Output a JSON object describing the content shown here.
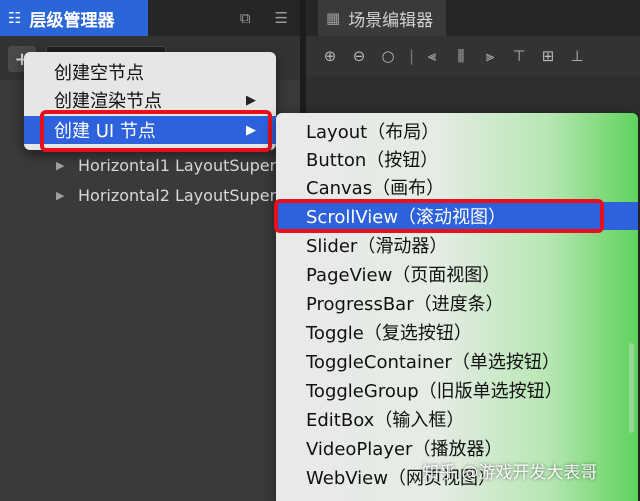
{
  "hierarchy": {
    "tab_title": "层级管理器",
    "tab_icon": "hierarchy-icon",
    "tree": [
      {
        "label": "Horizontal1 LayoutSuper"
      },
      {
        "label": "Horizontal2 LayoutSuper"
      }
    ]
  },
  "scene": {
    "tab_title": "场景编辑器"
  },
  "context_menu": {
    "items": [
      {
        "label": "创建空节点",
        "has_submenu": false
      },
      {
        "label": "创建渲染节点",
        "has_submenu": true
      },
      {
        "label": "创建 UI 节点",
        "has_submenu": true,
        "active": true
      }
    ]
  },
  "submenu": {
    "items": [
      {
        "label": "Layout（布局）"
      },
      {
        "label": "Button（按钮）"
      },
      {
        "label": "Canvas（画布）"
      },
      {
        "label": "ScrollView（滚动视图）",
        "active": true
      },
      {
        "label": "Slider（滑动器）"
      },
      {
        "label": "PageView（页面视图）"
      },
      {
        "label": "ProgressBar（进度条）"
      },
      {
        "label": "Toggle（复选按钮）"
      },
      {
        "label": "ToggleContainer（单选按钮）"
      },
      {
        "label": "ToggleGroup（旧版单选按钮）"
      },
      {
        "label": "EditBox（输入框）"
      },
      {
        "label": "VideoPlayer（播放器）"
      },
      {
        "label": "WebView（网页视图）"
      }
    ]
  },
  "watermark": "知乎 @游戏开发大表哥",
  "colors": {
    "accent": "#2d62dc",
    "highlight_border": "#e8101a"
  }
}
